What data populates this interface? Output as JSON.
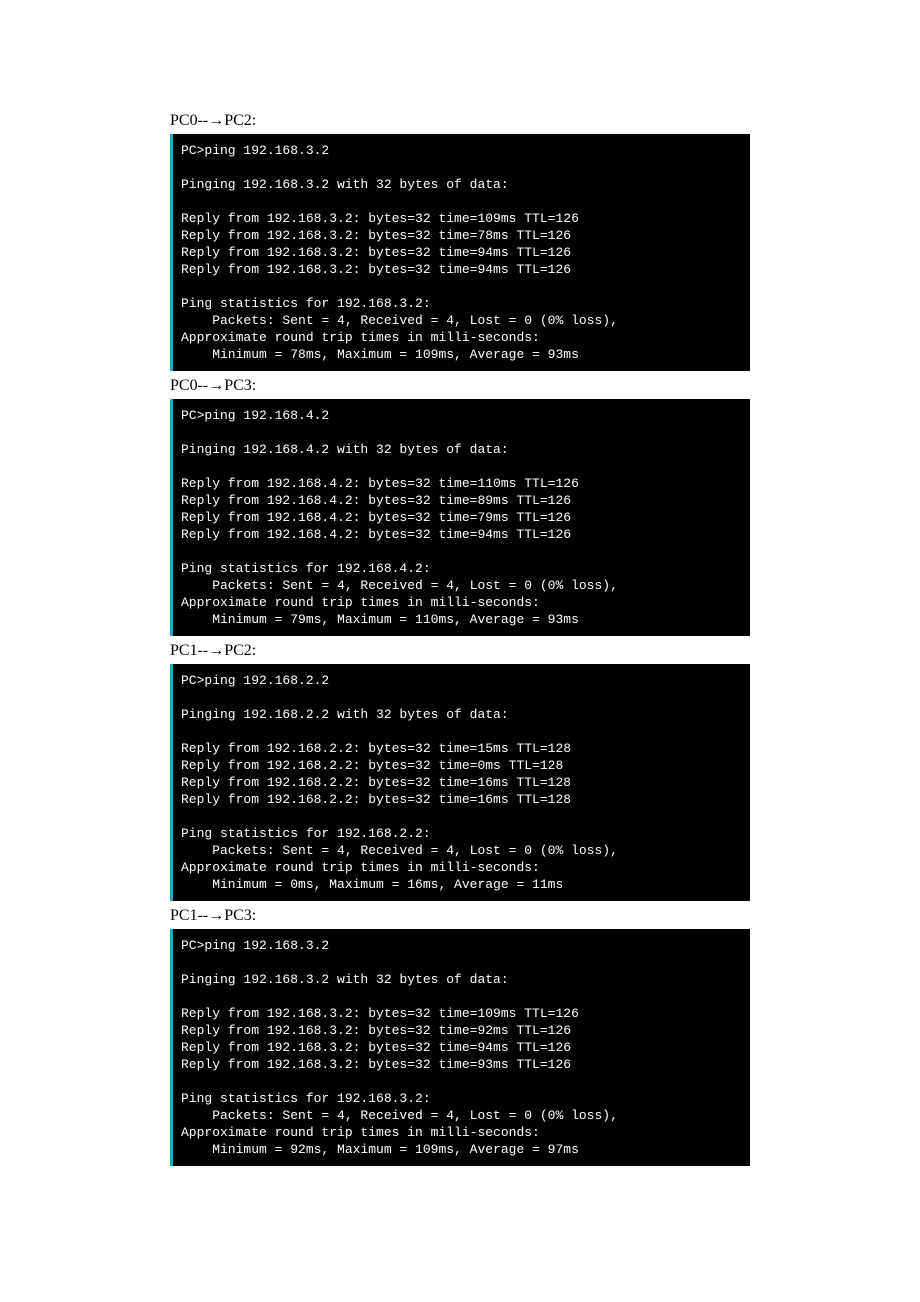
{
  "blocks": [
    {
      "caption": "PC0--→PC2:",
      "lines": [
        "PC>ping 192.168.3.2",
        "",
        "Pinging 192.168.3.2 with 32 bytes of data:",
        "",
        "Reply from 192.168.3.2: bytes=32 time=109ms TTL=126",
        "Reply from 192.168.3.2: bytes=32 time=78ms TTL=126",
        "Reply from 192.168.3.2: bytes=32 time=94ms TTL=126",
        "Reply from 192.168.3.2: bytes=32 time=94ms TTL=126",
        "",
        "Ping statistics for 192.168.3.2:",
        "    Packets: Sent = 4, Received = 4, Lost = 0 (0% loss),",
        "Approximate round trip times in milli-seconds:",
        "    Minimum = 78ms, Maximum = 109ms, Average = 93ms"
      ]
    },
    {
      "caption": "PC0--→PC3:",
      "lines": [
        "PC>ping 192.168.4.2",
        "",
        "Pinging 192.168.4.2 with 32 bytes of data:",
        "",
        "Reply from 192.168.4.2: bytes=32 time=110ms TTL=126",
        "Reply from 192.168.4.2: bytes=32 time=89ms TTL=126",
        "Reply from 192.168.4.2: bytes=32 time=79ms TTL=126",
        "Reply from 192.168.4.2: bytes=32 time=94ms TTL=126",
        "",
        "Ping statistics for 192.168.4.2:",
        "    Packets: Sent = 4, Received = 4, Lost = 0 (0% loss),",
        "Approximate round trip times in milli-seconds:",
        "    Minimum = 79ms, Maximum = 110ms, Average = 93ms"
      ]
    },
    {
      "caption": "PC1--→PC2:",
      "lines": [
        "PC>ping 192.168.2.2",
        "",
        "Pinging 192.168.2.2 with 32 bytes of data:",
        "",
        "Reply from 192.168.2.2: bytes=32 time=15ms TTL=128",
        "Reply from 192.168.2.2: bytes=32 time=0ms TTL=128",
        "Reply from 192.168.2.2: bytes=32 time=16ms TTL=128",
        "Reply from 192.168.2.2: bytes=32 time=16ms TTL=128",
        "",
        "Ping statistics for 192.168.2.2:",
        "    Packets: Sent = 4, Received = 4, Lost = 0 (0% loss),",
        "Approximate round trip times in milli-seconds:",
        "    Minimum = 0ms, Maximum = 16ms, Average = 11ms"
      ]
    },
    {
      "caption": "PC1--→PC3:",
      "lines": [
        "PC>ping 192.168.3.2",
        "",
        "Pinging 192.168.3.2 with 32 bytes of data:",
        "",
        "Reply from 192.168.3.2: bytes=32 time=109ms TTL=126",
        "Reply from 192.168.3.2: bytes=32 time=92ms TTL=126",
        "Reply from 192.168.3.2: bytes=32 time=94ms TTL=126",
        "Reply from 192.168.3.2: bytes=32 time=93ms TTL=126",
        "",
        "Ping statistics for 192.168.3.2:",
        "    Packets: Sent = 4, Received = 4, Lost = 0 (0% loss),",
        "Approximate round trip times in milli-seconds:",
        "    Minimum = 92ms, Maximum = 109ms, Average = 97ms"
      ]
    }
  ]
}
